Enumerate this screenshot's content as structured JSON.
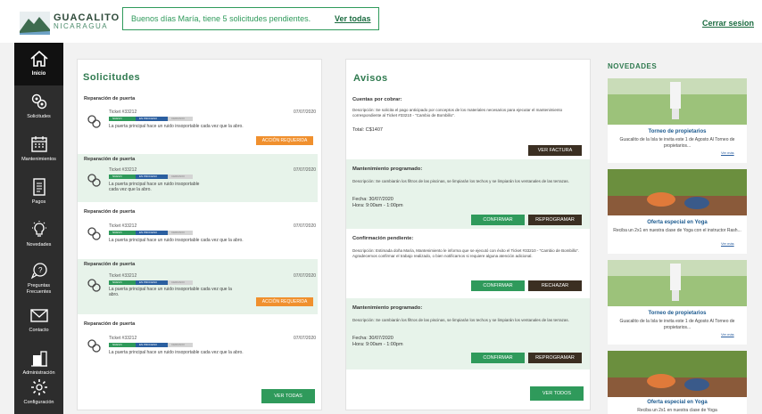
{
  "header": {
    "brand": "GUACALITO",
    "brand_sub": "NICARAGUA",
    "notice_text": "Buenos días María, tiene 5 solicitudes pendientes.",
    "notice_link": "Ver todas",
    "logout": "Cerrar sesion"
  },
  "sidebar": {
    "items": [
      {
        "label": "Inicio",
        "icon": "home-icon"
      },
      {
        "label": "Solicitudes",
        "icon": "gears-icon"
      },
      {
        "label": "Mantenimientos",
        "icon": "calendar-icon"
      },
      {
        "label": "Pagos",
        "icon": "document-icon"
      },
      {
        "label": "Novedades",
        "icon": "lightbulb-icon"
      },
      {
        "label": "Preguntas",
        "label2": "Frecuentes",
        "icon": "question-icon"
      },
      {
        "label": "Contacto",
        "icon": "mail-icon"
      },
      {
        "label": "Administración",
        "icon": "building-icon"
      },
      {
        "label": "Configuración",
        "icon": "settings-icon"
      }
    ]
  },
  "solicitudes": {
    "title": "Solicitudes",
    "steps": [
      "NUEVO",
      "EN PROCESO",
      "CERRADO"
    ],
    "items": [
      {
        "title": "Reparación de puerta",
        "ticket": "Ticket #33212",
        "date": "07/07/2020",
        "desc": "La puerta principal hace un ruido insoportable cada vez que la abro.",
        "action": "ACCIÓN REQUERIDA"
      },
      {
        "title": "Reparación de puerta",
        "ticket": "Ticket #33212",
        "date": "07/07/2020",
        "desc": "La puerta principal hace un ruido insoportable cada vez que la abro."
      },
      {
        "title": "Reparación de puerta",
        "ticket": "Ticket #33212",
        "date": "07/07/2020",
        "desc": "La puerta principal hace un ruido insoportable cada vez que la abro."
      },
      {
        "title": "Reparación de puerta",
        "ticket": "Ticket #33212",
        "date": "07/07/2020",
        "desc": "La puerta principal hace un ruido insoportable cada vez que la abro.",
        "action": "ACCIÓN REQUERIDA"
      },
      {
        "title": "Reparación de puerta",
        "ticket": "Ticket #33212",
        "date": "07/07/2020",
        "desc": "La puerta principal hace un ruido insoportable cada vez que la abro."
      }
    ],
    "view_all": "VER TODAS"
  },
  "avisos": {
    "title": "Avisos",
    "cuentas": {
      "title": "Cuentas por cobrar:",
      "desc": "Descripción: Se solicita el pago anticipado por conceptos de los materiales necesarios para ejecutar el mantenimiento correspondiente al Ticket #33210 - “Cambio de Bombillo”.",
      "total": "Total: C$1407",
      "button": "VER FACTURA"
    },
    "mant1": {
      "title": "Mantenimiento programado:",
      "desc": "Descripción: Se cambiarán los filtros de las piscinas, se limpiarán los techos y se limpiarán los ventanales de las terrazas.",
      "fecha": "Fecha: 30/07/2020",
      "hora": "Hora: 9:00am - 1:00pm",
      "confirm": "CONFIRMAR",
      "reprogram": "REPROGRAMAR"
    },
    "confirmacion": {
      "title": "Confirmación pendiente:",
      "desc": "Descripción: Estimada doña María, Mantenimiento le informa que se ejecutó con éxito el Ticket #33210 - “Cambio de Bombillo”. Agradecemos confirmar el trabajo realizado, o bien notificarnos si requiere alguna atención adicional.",
      "confirm": "CONFIRMAR",
      "reject": "RECHAZAR"
    },
    "mant2": {
      "title": "Mantenimiento programado:",
      "desc": "Descripción: Se cambiarán los filtros de las piscinas, se limpiarán los techos y se limpiarán los ventanales de las terrazas.",
      "fecha": "Fecha: 30/07/2020",
      "hora": "Hora: 9:00am - 1:00pm",
      "confirm": "CONFIRMAR",
      "reprogram": "REPROGRAMAR"
    },
    "view_all": "VER TODOS"
  },
  "novedades": {
    "title": "NOVEDADES",
    "items": [
      {
        "title": "Torneo de propietarios",
        "desc": "Guacalito de la Isla te invita este 1 de Agosto Al Torneo de propietarios...",
        "more": "Ver más"
      },
      {
        "title": "Oferta especial en Yoga",
        "desc": "Reciba un 2x1 en nuestra clase de Yoga con el instructor Rash...",
        "more": "Ver más"
      },
      {
        "title": "Torneo de propietarios",
        "desc": "Guacalito de la Isla te invita este 1 de Agosto Al Torneo de propietarios...",
        "more": "Ver más"
      },
      {
        "title": "Oferta especial en Yoga",
        "desc": "Reciba un 2x1 en nuestra clase de Yoga"
      }
    ]
  },
  "colors": {
    "accent": "#2f9a5b",
    "dark": "#2d2d2d",
    "orange": "#f0902e",
    "blue": "#2b5fa0"
  }
}
